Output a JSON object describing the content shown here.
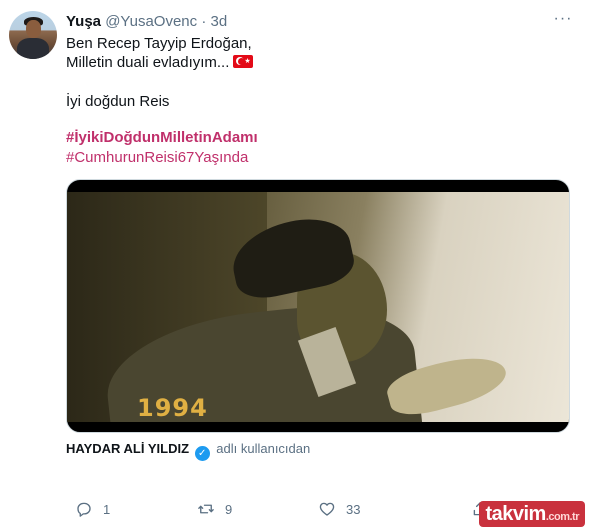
{
  "tweet": {
    "name": "Yuşa",
    "handle": "@YusaOvenc",
    "separator": "·",
    "time": "3d",
    "more_label": "···",
    "lines": [
      "Ben Recep Tayyip Erdoğan,",
      "Milletin duali evladıyım..."
    ],
    "line3": "İyi doğdun Reis",
    "hashtag1": "#İyikiDoğdunMilletinAdamı",
    "hashtag2": "#CumhurunReisi67Yaşında",
    "flag_icon": "turkish-flag-emoji"
  },
  "media": {
    "overlay_year": "1994"
  },
  "attribution": {
    "name": "HAYDAR ALİ YILDIZ",
    "verified_icon": "verified-badge-icon",
    "suffix": "adlı kullanıcıdan"
  },
  "actions": {
    "reply_count": "1",
    "retweet_count": "9",
    "like_count": "33",
    "share_label": ""
  },
  "watermark": {
    "text": "takvim",
    "suffix": ".com.tr"
  },
  "colors": {
    "hashtag": "#c0306b",
    "muted": "#5b7083",
    "verified": "#1d9bf0",
    "brand": "#c9313d"
  }
}
